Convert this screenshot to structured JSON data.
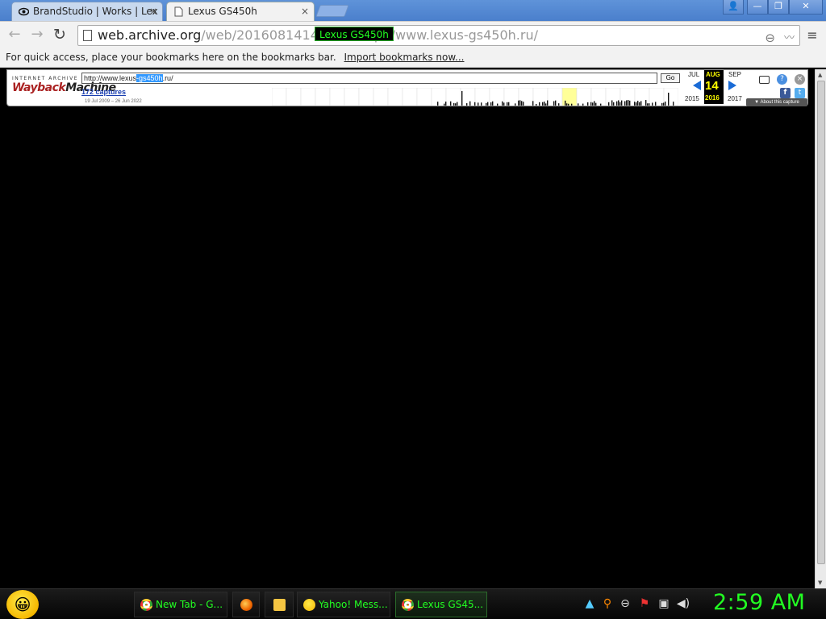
{
  "tabs": [
    {
      "title": "BrandStudio | Works | Lex",
      "close": "×"
    },
    {
      "title": "Lexus GS450h",
      "close": "×"
    }
  ],
  "window_controls": {
    "user": "👤",
    "minimize": "—",
    "maximize": "❐",
    "close": "✕"
  },
  "toolbar": {
    "back": "←",
    "forward": "→",
    "reload": "↻",
    "url_host": "web.archive.org",
    "url_path": "/web/20160814142835/http://www.lexus-gs450h.ru/",
    "menu": "≡",
    "zoom": "⊖",
    "tooltip": "Lexus GS450h"
  },
  "bookmarks_bar": {
    "message": "For quick access, place your bookmarks here on the bookmarks bar.",
    "import_link": "Import bookmarks now..."
  },
  "wayback": {
    "ia_label": "INTERNET ARCHIVE",
    "logo_a": "Wayback",
    "logo_b": "Machine",
    "url_pre": "http://www.lexus",
    "url_sel": "-gs450h",
    "url_post": ".ru/",
    "go_label": "Go",
    "captures": "172 captures",
    "range": "19 Jul 2009 – 26 Jun 2022",
    "prev_month": "JUL",
    "cur_month": "AUG",
    "next_month": "SEP",
    "prev_year": "2015",
    "cur_year": "2016",
    "next_year": "2017",
    "day": "14",
    "about": "▼ About this capture",
    "fb": "f",
    "tw": "t",
    "help": "?",
    "close": "×"
  },
  "taskbar": {
    "start_icon": "😀",
    "tasks": [
      {
        "label": "New Tab - G..."
      },
      {
        "label": ""
      },
      {
        "label": ""
      },
      {
        "label": "Yahoo! Mess..."
      },
      {
        "label": "Lexus GS45..."
      }
    ],
    "clock": "2:59 AM"
  },
  "colors": {
    "accent_green": "#22ff22",
    "titlebar_blue": "#4a7fcc",
    "wayback_yellow": "#ffff00"
  }
}
